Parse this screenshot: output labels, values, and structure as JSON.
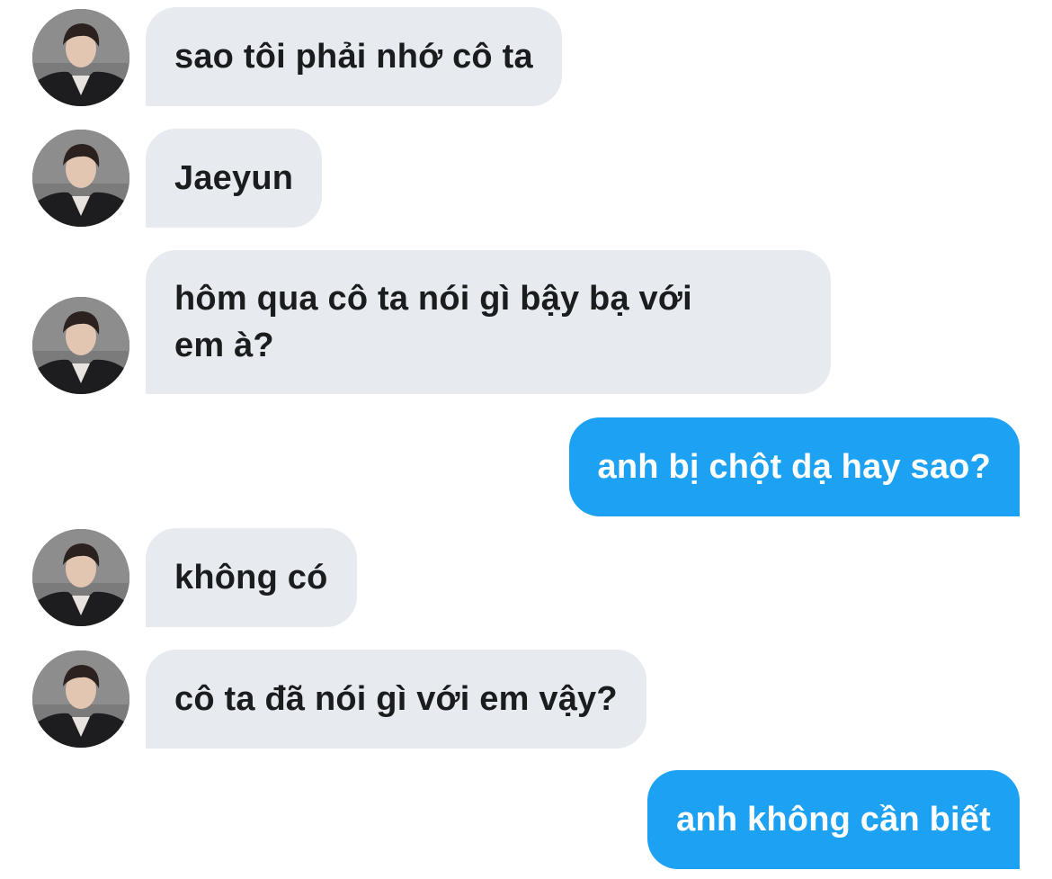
{
  "chat": {
    "avatar_icon": "profile-photo-icon",
    "incoming_color": "#e7ebef",
    "outgoing_color": "#1da1f2",
    "messages": [
      {
        "sender": "them",
        "text": "sao tôi phải nhớ cô ta"
      },
      {
        "sender": "them",
        "text": "Jaeyun"
      },
      {
        "sender": "them",
        "text": "hôm qua cô ta nói gì bậy bạ với em à?"
      },
      {
        "sender": "me",
        "text": "anh bị chột dạ hay sao?"
      },
      {
        "sender": "them",
        "text": "không có"
      },
      {
        "sender": "them",
        "text": "cô ta đã nói gì với em vậy?"
      },
      {
        "sender": "me",
        "text": "anh không cần biết"
      }
    ]
  }
}
